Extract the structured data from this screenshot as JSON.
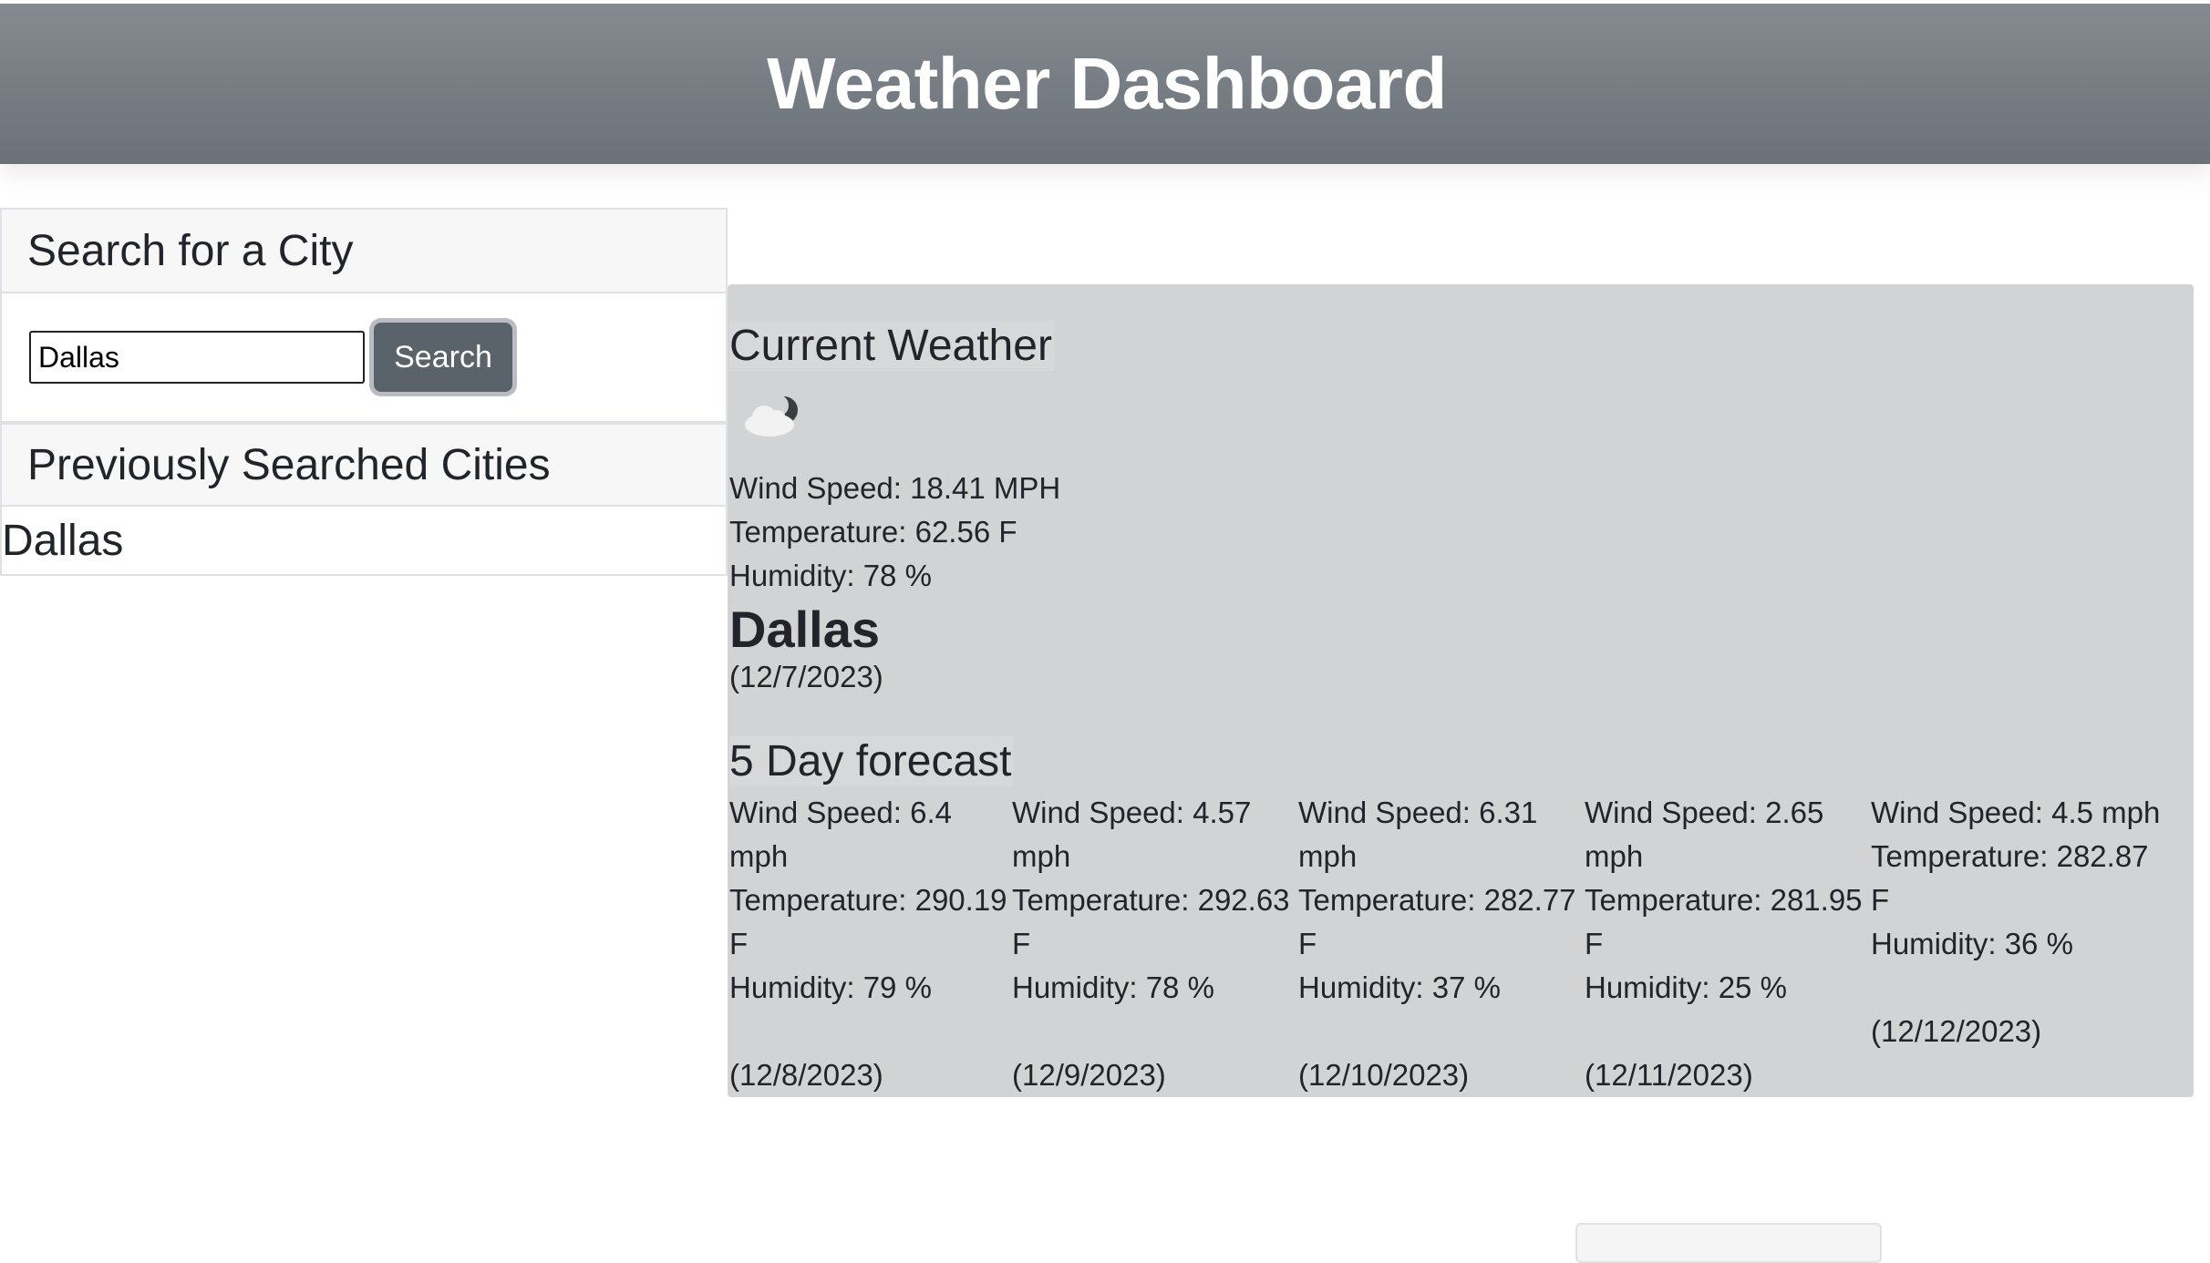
{
  "header": {
    "title": "Weather Dashboard"
  },
  "search": {
    "title": "Search for a City",
    "input_value": "Dallas",
    "button_label": "Search"
  },
  "previous": {
    "title": "Previously Searched Cities",
    "items": [
      "Dallas"
    ]
  },
  "current": {
    "title": "Current Weather",
    "icon": "partly-cloudy-night-icon",
    "wind": "Wind Speed: 18.41 MPH",
    "temperature": "Temperature: 62.56 F",
    "humidity": "Humidity: 78 %",
    "city": "Dallas",
    "date": "(12/7/2023)"
  },
  "forecast": {
    "title": "5 Day forecast",
    "days": [
      {
        "wind_a": "Wind Speed: 6.4",
        "wind_b": "mph",
        "temp_a": "Temperature: 290.19",
        "temp_b": "F",
        "humidity": "Humidity: 79 %",
        "date": "(12/8/2023)"
      },
      {
        "wind_a": "Wind Speed: 4.57",
        "wind_b": "mph",
        "temp_a": "Temperature: 292.63",
        "temp_b": "F",
        "humidity": "Humidity: 78 %",
        "date": "(12/9/2023)"
      },
      {
        "wind_a": "Wind Speed: 6.31",
        "wind_b": "mph",
        "temp_a": "Temperature: 282.77",
        "temp_b": "F",
        "humidity": "Humidity: 37 %",
        "date": "(12/10/2023)"
      },
      {
        "wind_a": "Wind Speed: 2.65",
        "wind_b": "mph",
        "temp_a": "Temperature: 281.95",
        "temp_b": "F",
        "humidity": "Humidity: 25 %",
        "date": "(12/11/2023)"
      },
      {
        "wind_a": "Wind Speed: 4.5 mph",
        "temp_a": "Temperature: 282.87",
        "temp_b": "F",
        "humidity": "Humidity: 36 %",
        "date": "(12/12/2023)"
      }
    ]
  }
}
